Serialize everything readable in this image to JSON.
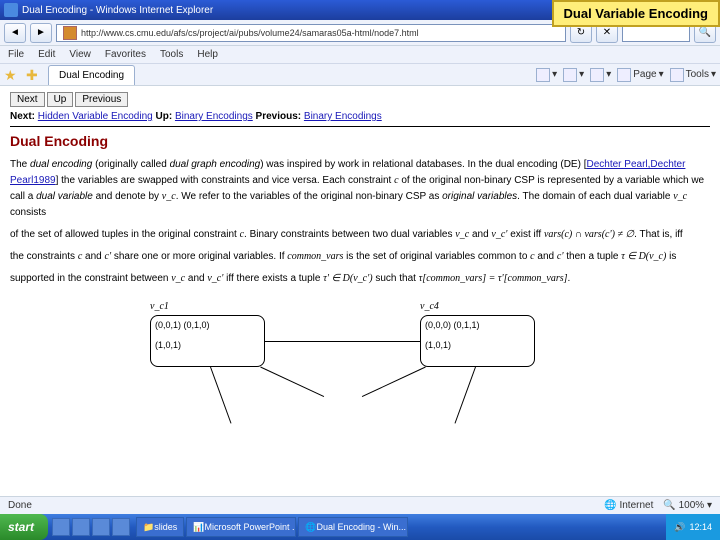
{
  "overlay": "Dual Variable Encoding",
  "window": {
    "title": "Dual Encoding - Windows Internet Explorer",
    "url": "http://www.cs.cmu.edu/afs/cs/project/ai/pubs/volume24/samaras05a-html/node7.html"
  },
  "menu": {
    "file": "File",
    "edit": "Edit",
    "view": "View",
    "favorites": "Favorites",
    "tools": "Tools",
    "help": "Help"
  },
  "tab": "Dual Encoding",
  "rtools": {
    "page": "Page",
    "tools": "Tools"
  },
  "nav_buttons": {
    "next": "Next",
    "up": "Up",
    "previous": "Previous"
  },
  "navline": {
    "next_lbl": "Next:",
    "next_link": "Hidden Variable Encoding",
    "up_lbl": "Up:",
    "up_link": "Binary Encodings",
    "prev_lbl": "Previous:",
    "prev_link": "Binary Encodings"
  },
  "heading": "Dual Encoding",
  "body": {
    "p1a": "The ",
    "p1b": "dual encoding",
    "p1c": " (originally called ",
    "p1d": "dual graph encoding",
    "p1e": ") was inspired by work in relational databases. In the dual encoding (DE) [",
    "p1f": "Dechter Pearl,Dechter Pearl1989",
    "p1g": "] the variables are swapped with constraints and vice versa. Each constraint ",
    "m1": "c",
    "p1h": " of the original non-binary CSP is represented by a variable which we call a ",
    "p1i": "dual variable",
    "p1j": " and denote by ",
    "m2": "v_c",
    "p1k": ". We refer to the variables of the original non-binary CSP as ",
    "p1l": "original variables",
    "p1m": ". The domain of each dual variable ",
    "m3": "v_c",
    "p1n": " consists",
    "p2a": "of the set of allowed tuples in the original constraint ",
    "m4": "c",
    "p2b": ". Binary constraints between two dual variables ",
    "m5": "v_c",
    "p2c": " and ",
    "m6": "v_c'",
    "p2d": " exist iff ",
    "m7": "vars(c) ∩ vars(c') ≠ ∅",
    "p2e": ". That is, iff",
    "p3a": "the constraints ",
    "m8": "c",
    "p3b": " and ",
    "m9": "c'",
    "p3c": " share one or more original variables. If ",
    "m10": "common_vars",
    "p3d": " is the set of original variables common to ",
    "m11": "c",
    "p3e": " and ",
    "m12": "c'",
    "p3f": " then a tuple ",
    "m13": "τ ∈ D(v_c)",
    "p3g": " is",
    "p4a": "supported in the constraint between ",
    "m14": "v_c",
    "p4b": " and ",
    "m15": "v_c'",
    "p4c": " iff there exists a tuple ",
    "m16": "τ' ∈ D(v_c')",
    "p4d": " such that ",
    "m17": "τ[common_vars] = τ'[common_vars]",
    "p4e": "."
  },
  "diagram": {
    "label_left": "v_c1",
    "label_right": "v_c4",
    "node_left": "(0,0,1) (0,1,0)\n\n(1,0,1)",
    "node_right": "(0,0,0) (0,1,1)\n\n(1,0,1)"
  },
  "status": {
    "left": "Done",
    "mid": "Internet",
    "zoom": "100%"
  },
  "taskbar": {
    "start": "start",
    "t1": "slides",
    "t2": "Microsoft PowerPoint ...",
    "t3": "Dual Encoding - Win...",
    "time": "12:14"
  }
}
